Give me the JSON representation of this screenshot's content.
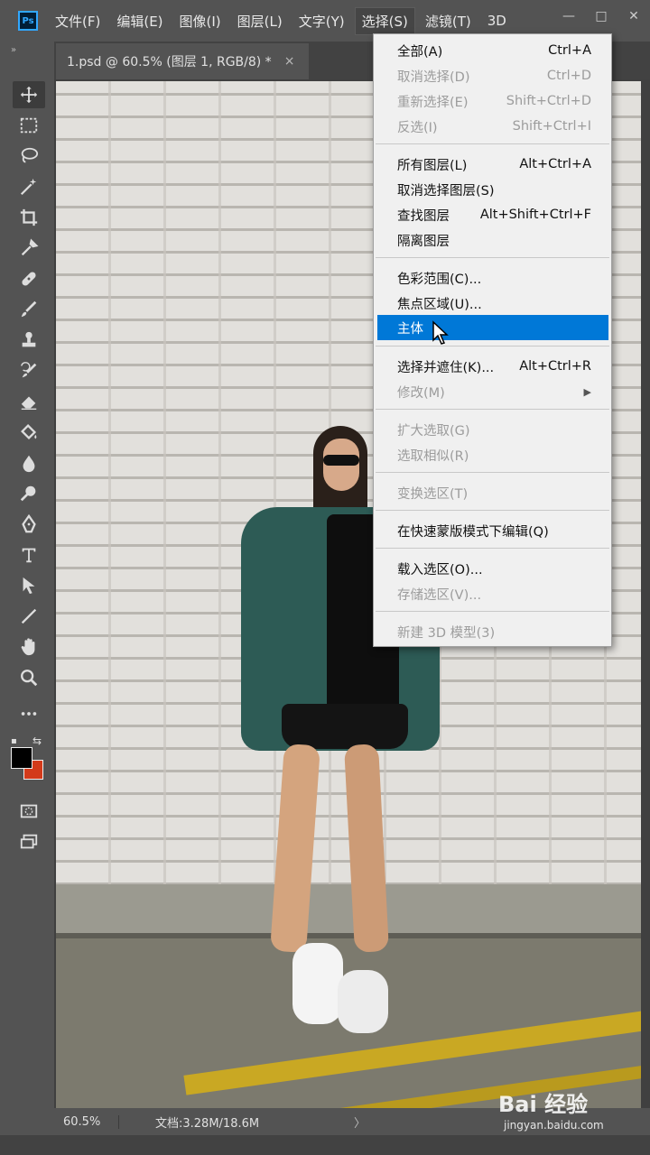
{
  "app": {
    "logo": "Ps"
  },
  "menubar": {
    "items": [
      "文件(F)",
      "编辑(E)",
      "图像(I)",
      "图层(L)",
      "文字(Y)",
      "选择(S)",
      "滤镜(T)",
      "3D"
    ],
    "active_index": 5
  },
  "window_controls": {
    "minimize": "—",
    "maximize": "□",
    "close": "✕"
  },
  "tabs": {
    "expander": "»",
    "document_tab": "1.psd @ 60.5% (图层 1, RGB/8) *",
    "close": "×"
  },
  "toolbar": {
    "tools": [
      "move-icon",
      "marquee-icon",
      "lasso-icon",
      "magic-wand-icon",
      "crop-icon",
      "eyedropper-icon",
      "healing-brush-icon",
      "brush-icon",
      "clone-stamp-icon",
      "history-brush-icon",
      "eraser-icon",
      "paint-bucket-icon",
      "blur-icon",
      "dodge-icon",
      "pen-icon",
      "type-icon",
      "path-selection-icon",
      "line-icon",
      "hand-icon",
      "zoom-icon",
      "more-icon"
    ],
    "foreground_color": "#000000",
    "background_color": "#d33a1a"
  },
  "status": {
    "zoom": "60.5%",
    "doc_info": "文档:3.28M/18.6M",
    "arrow": "〉"
  },
  "select_menu": {
    "items": [
      {
        "label": "全部(A)",
        "shortcut": "Ctrl+A",
        "disabled": false
      },
      {
        "label": "取消选择(D)",
        "shortcut": "Ctrl+D",
        "disabled": true
      },
      {
        "label": "重新选择(E)",
        "shortcut": "Shift+Ctrl+D",
        "disabled": true
      },
      {
        "label": "反选(I)",
        "shortcut": "Shift+Ctrl+I",
        "disabled": true
      },
      {
        "label": "所有图层(L)",
        "shortcut": "Alt+Ctrl+A",
        "disabled": false
      },
      {
        "label": "取消选择图层(S)",
        "shortcut": "",
        "disabled": false
      },
      {
        "label": "查找图层",
        "shortcut": "Alt+Shift+Ctrl+F",
        "disabled": false
      },
      {
        "label": "隔离图层",
        "shortcut": "",
        "disabled": false
      },
      {
        "label": "色彩范围(C)...",
        "shortcut": "",
        "disabled": false
      },
      {
        "label": "焦点区域(U)...",
        "shortcut": "",
        "disabled": false
      },
      {
        "label": "主体",
        "shortcut": "",
        "disabled": false,
        "highlighted": true
      },
      {
        "label": "选择并遮住(K)...",
        "shortcut": "Alt+Ctrl+R",
        "disabled": false
      },
      {
        "label": "修改(M)",
        "shortcut": "",
        "disabled": true,
        "submenu": true
      },
      {
        "label": "扩大选取(G)",
        "shortcut": "",
        "disabled": true
      },
      {
        "label": "选取相似(R)",
        "shortcut": "",
        "disabled": true
      },
      {
        "label": "变换选区(T)",
        "shortcut": "",
        "disabled": true
      },
      {
        "label": "在快速蒙版模式下编辑(Q)",
        "shortcut": "",
        "disabled": false
      },
      {
        "label": "载入选区(O)...",
        "shortcut": "",
        "disabled": false
      },
      {
        "label": "存储选区(V)...",
        "shortcut": "",
        "disabled": true
      },
      {
        "label": "新建 3D 模型(3)",
        "shortcut": "",
        "disabled": true
      }
    ],
    "submenu_arrow": "▶"
  },
  "watermark": {
    "logo": "Bai 经验",
    "url": "jingyan.baidu.com"
  }
}
